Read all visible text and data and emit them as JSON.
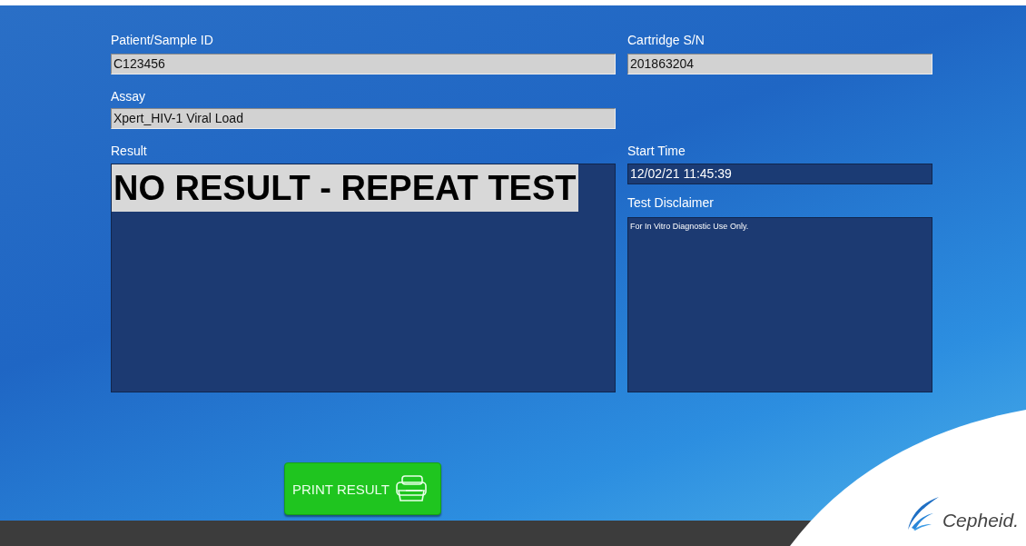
{
  "patient_sample_id": {
    "label": "Patient/Sample ID",
    "value": "C123456"
  },
  "cartridge_sn": {
    "label": "Cartridge S/N",
    "value": "201863204"
  },
  "assay": {
    "label": "Assay",
    "value": "Xpert_HIV-1 Viral Load"
  },
  "result": {
    "label": "Result",
    "value": "NO RESULT - REPEAT TEST"
  },
  "start_time": {
    "label": "Start Time",
    "value": "12/02/21 11:45:39"
  },
  "test_disclaimer": {
    "label": "Test Disclaimer",
    "value": "For In Vitro Diagnostic Use Only."
  },
  "print_button": {
    "label": "PRINT RESULT"
  },
  "logo": {
    "text": "Cepheid."
  }
}
